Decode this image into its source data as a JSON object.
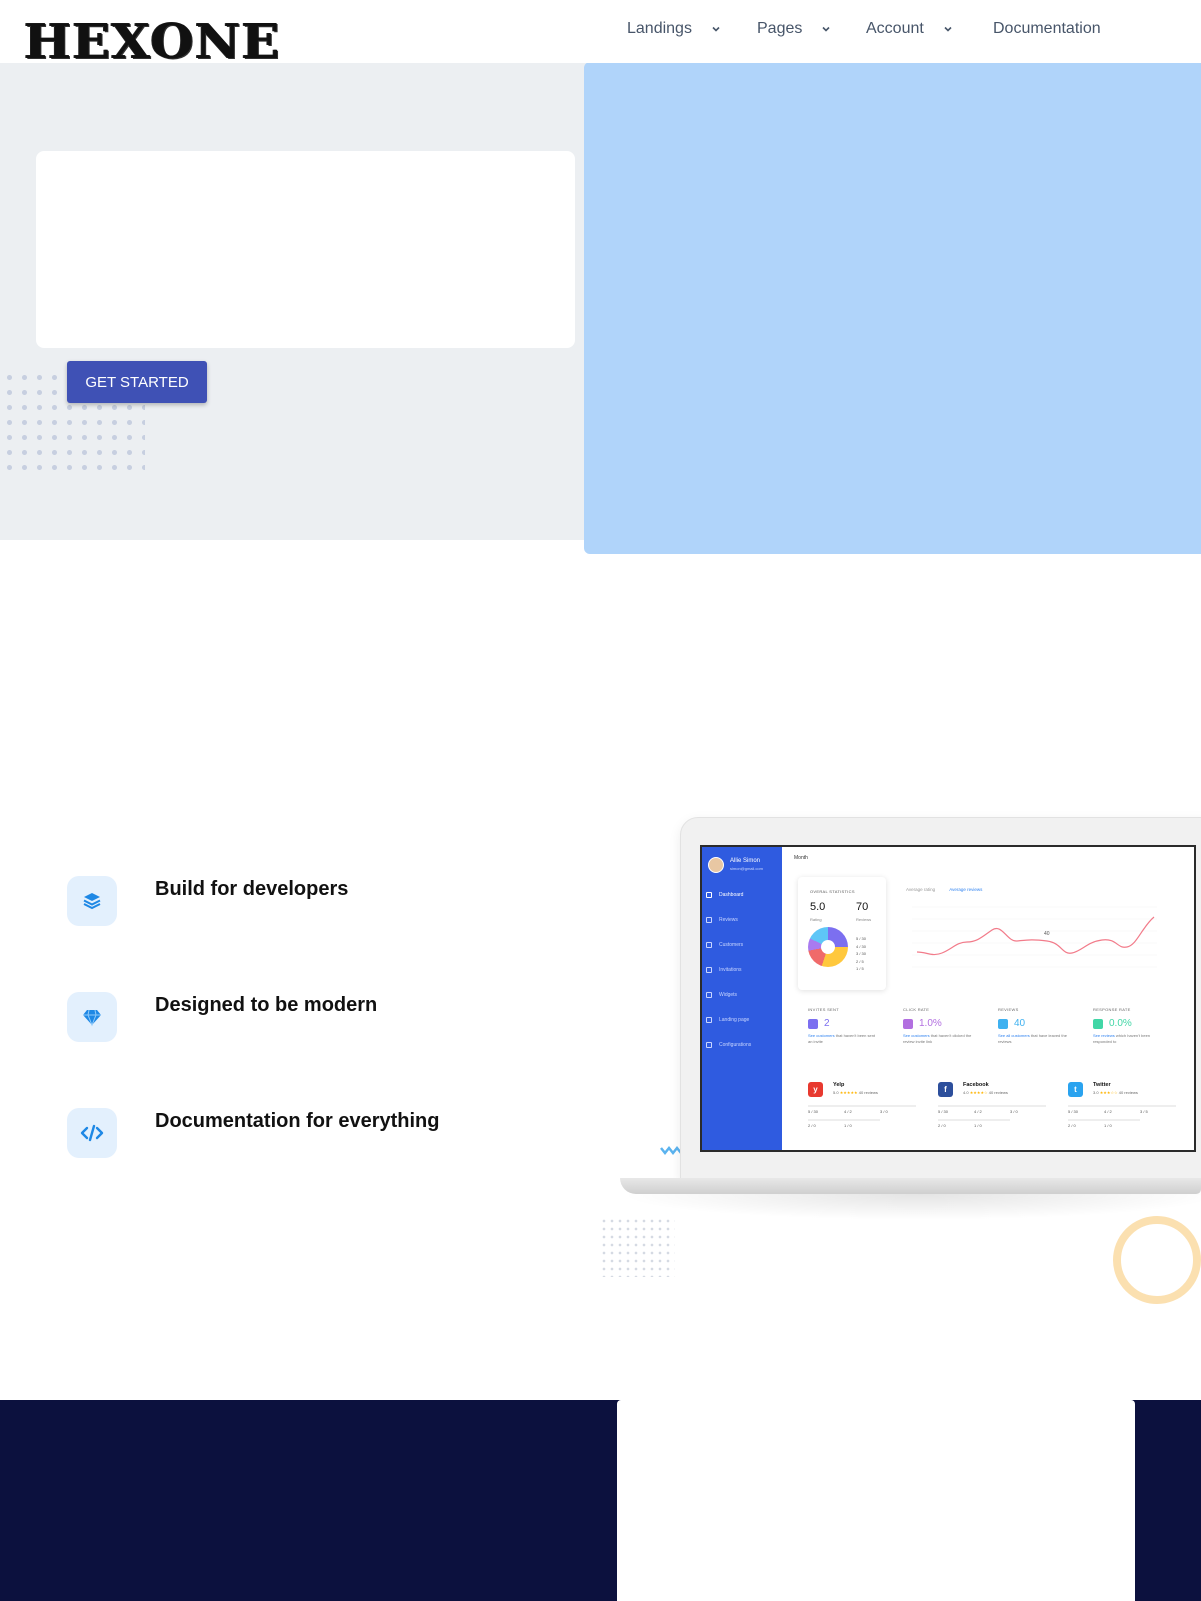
{
  "header": {
    "logo_text": "HEXONE",
    "nav": [
      {
        "label": "Landings",
        "has_dropdown": true
      },
      {
        "label": "Pages",
        "has_dropdown": true
      },
      {
        "label": "Account",
        "has_dropdown": true
      },
      {
        "label": "Documentation",
        "has_dropdown": false
      }
    ]
  },
  "hero": {
    "cta_label": "GET STARTED"
  },
  "features": [
    {
      "icon": "layers-icon",
      "title": "Build for developers"
    },
    {
      "icon": "diamond-icon",
      "title": "Designed to be modern"
    },
    {
      "icon": "code-icon",
      "title": "Documentation for everything"
    }
  ],
  "mockup": {
    "user_name": "Allie Simon",
    "user_email": "simon@gmail.com",
    "period": "Month",
    "sidebar": [
      "Dashboard",
      "Reviews",
      "Customers",
      "Invitations",
      "Widgets",
      "Landing page",
      "Configurations"
    ],
    "stats_title": "OVERAL STATISTICS",
    "rating_value": "5.0",
    "rating_label": "Rating",
    "reviews_value": "70",
    "reviews_label": "Reviews",
    "legend": [
      "5 / 30",
      "4 / 30",
      "3 / 30",
      "2 / 5",
      "1 / 5"
    ],
    "chart_tabs": [
      "Average rating",
      "Average reviews"
    ],
    "chart_point_label": "40",
    "kpis": [
      {
        "label": "INVITES SENT",
        "value": "2",
        "color": "#7c6ff0",
        "desc_link": "See customers",
        "desc": " that haven't been sent an invite"
      },
      {
        "label": "CLICK RATE",
        "value": "1.0%",
        "color": "#b26fe0",
        "desc_link": "See customers",
        "desc": " that haven't clicked the review invite link"
      },
      {
        "label": "REVIEWS",
        "value": "40",
        "color": "#3fb1f0",
        "desc_link": "See all customers",
        "desc": " that have leaved the reviews"
      },
      {
        "label": "RESPONSE RATE",
        "value": "0.0%",
        "color": "#41d6a6",
        "desc_link": "See reviews",
        "desc": " which haven't been responded to"
      }
    ],
    "platforms": [
      {
        "name": "Yelp",
        "score": "5.0",
        "reviews": "40 reviews",
        "color": "#e8392f",
        "glyph": "y",
        "bars": [
          "5 / 30",
          "4 / 2",
          "3 / 0",
          "2 / 0",
          "1 / 0"
        ]
      },
      {
        "name": "Facebook",
        "score": "4.0",
        "reviews": "40 reviews",
        "color": "#2d4f9c",
        "glyph": "f",
        "bars": [
          "5 / 30",
          "4 / 2",
          "3 / 0",
          "2 / 0",
          "1 / 0"
        ]
      },
      {
        "name": "Twitter",
        "score": "3.0",
        "reviews": "40 reviews",
        "color": "#2aa3ef",
        "glyph": "t",
        "bars": [
          "5 / 30",
          "4 / 2",
          "3 / 5",
          "2 / 0",
          "1 / 0"
        ]
      }
    ]
  }
}
